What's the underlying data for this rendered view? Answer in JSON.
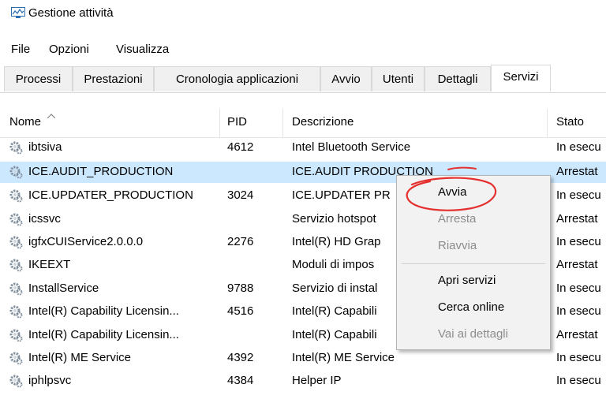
{
  "window": {
    "title": "Gestione attività"
  },
  "menubar": [
    "File",
    "Opzioni",
    "Visualizza"
  ],
  "tabs": [
    "Processi",
    "Prestazioni",
    "Cronologia applicazioni",
    "Avvio",
    "Utenti",
    "Dettagli",
    "Servizi"
  ],
  "active_tab": "Servizi",
  "table": {
    "columns": [
      "Nome",
      "PID",
      "Descrizione",
      "Stato"
    ],
    "sorted_by": "Nome",
    "rows": [
      {
        "name": "ibtsiva",
        "pid": "4612",
        "desc": "Intel Bluetooth Service",
        "state": "In esecu"
      },
      {
        "name": "ICE.AUDIT_PRODUCTION",
        "pid": "",
        "desc": "ICE.AUDIT PRODUCTION",
        "state": "Arrestat"
      },
      {
        "name": "ICE.UPDATER_PRODUCTION",
        "pid": "3024",
        "desc": "ICE.UPDATER PR",
        "state": "In esecu"
      },
      {
        "name": "icssvc",
        "pid": "",
        "desc": "Servizio hotspot",
        "state": "Arrestat"
      },
      {
        "name": "igfxCUIService2.0.0.0",
        "pid": "2276",
        "desc": "Intel(R) HD Grap",
        "state": "In esecu"
      },
      {
        "name": "IKEEXT",
        "pid": "",
        "desc": "Moduli di impos",
        "state": "Arrestat"
      },
      {
        "name": "InstallService",
        "pid": "9788",
        "desc": "Servizio di instal",
        "state": "In esecu"
      },
      {
        "name": "Intel(R) Capability Licensin...",
        "pid": "4516",
        "desc": "Intel(R) Capabili",
        "state": "In esecu"
      },
      {
        "name": "Intel(R) Capability Licensin...",
        "pid": "",
        "desc": "Intel(R) Capabili",
        "state": "Arrestat"
      },
      {
        "name": "Intel(R) ME Service",
        "pid": "4392",
        "desc": "Intel(R) ME Service",
        "state": "In esecu"
      },
      {
        "name": "iphlpsvc",
        "pid": "4384",
        "desc": "Helper IP",
        "state": "In esecu"
      }
    ]
  },
  "context_menu": {
    "items": [
      {
        "label": "Avvia",
        "enabled": true
      },
      {
        "label": "Arresta",
        "enabled": false
      },
      {
        "label": "Riavvia",
        "enabled": false
      },
      {
        "label": "Apri servizi",
        "enabled": true
      },
      {
        "label": "Cerca online",
        "enabled": true
      },
      {
        "label": "Vai ai dettagli",
        "enabled": false
      }
    ]
  },
  "colors": {
    "selected_row": "#cce8ff",
    "annotation": "#e53030",
    "menu_bg": "#f2f2f2",
    "disabled_text": "#8c8c8c"
  },
  "icons": {
    "app": "task-manager-icon",
    "service": "service-gear-icon",
    "sort": "sort-ascending-icon"
  }
}
